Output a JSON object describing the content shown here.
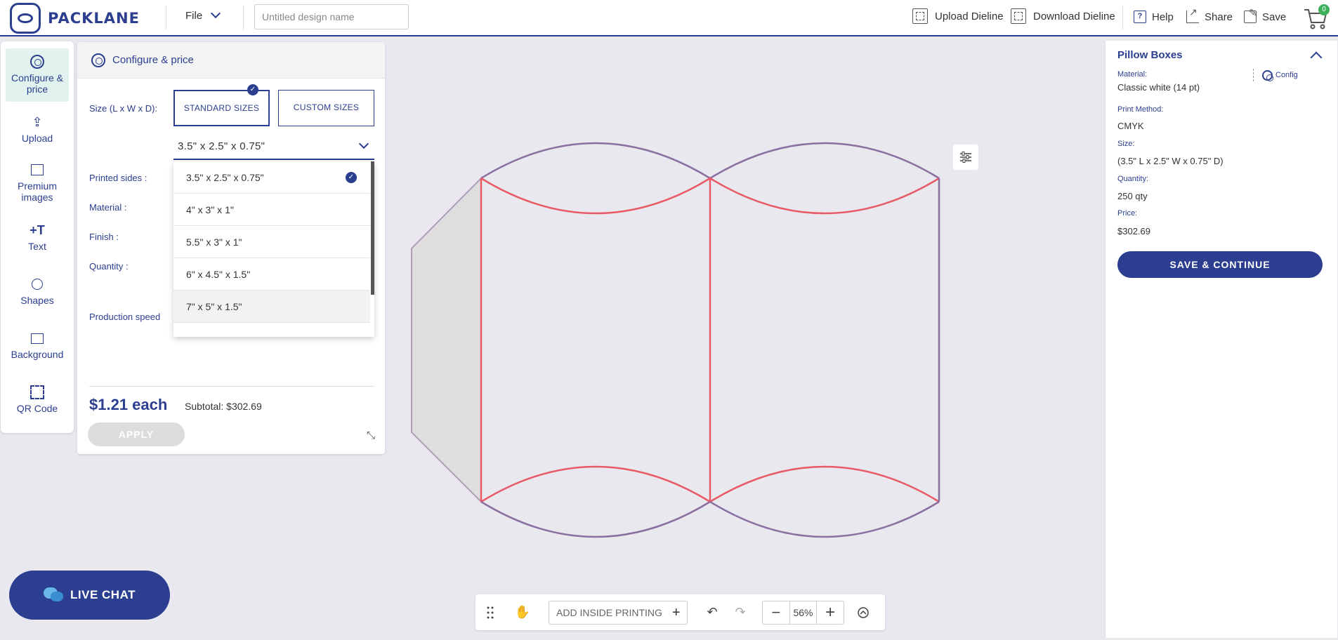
{
  "header": {
    "brand": "PACKLANE",
    "file_menu": "File",
    "design_name_placeholder": "Untitled design name",
    "upload_dieline": "Upload Dieline",
    "download_dieline": "Download Dieline",
    "help": "Help",
    "share": "Share",
    "save": "Save",
    "cart_count": "0"
  },
  "sidebar": {
    "items": [
      {
        "label": "Configure & price",
        "icon": "gear-icon"
      },
      {
        "label": "Upload",
        "icon": "upload-icon"
      },
      {
        "label": "Premium images",
        "icon": "image-icon"
      },
      {
        "label": "Text",
        "icon": "text-icon"
      },
      {
        "label": "Shapes",
        "icon": "shapes-icon"
      },
      {
        "label": "Background",
        "icon": "background-icon"
      },
      {
        "label": "QR Code",
        "icon": "qr-code-icon"
      }
    ]
  },
  "config": {
    "title": "Configure & price",
    "size_label": "Size (L x W x D):",
    "standard_sizes": "STANDARD SIZES",
    "custom_sizes": "CUSTOM SIZES",
    "selected_size": "3.5\" x 2.5\" x 0.75\"",
    "printed_sides_label": "Printed sides :",
    "material_label": "Material :",
    "finish_label": "Finish :",
    "quantity_label": "Quantity :",
    "production_speed_label": "Production speed",
    "size_options": [
      "3.5\" x 2.5\" x 0.75\"",
      "4\" x 3\" x 1\"",
      "5.5\" x 3\" x 1\"",
      "6\" x 4.5\" x 1.5\"",
      "7\" x 5\" x 1.5\""
    ],
    "price_each": "$1.21 each",
    "subtotal": "Subtotal: $302.69",
    "apply": "APPLY"
  },
  "summary": {
    "title": "Pillow Boxes",
    "config_link": "Config",
    "material_label": "Material:",
    "material_value": "Classic white (14 pt)",
    "print_method_label": "Print Method:",
    "print_method_value": "CMYK",
    "size_label": "Size:",
    "size_value": "(3.5\" L x 2.5\" W x 0.75\" D)",
    "quantity_label": "Quantity:",
    "quantity_value": "250 qty",
    "price_label": "Price:",
    "price_value": "$302.69",
    "save_continue": "SAVE & CONTINUE"
  },
  "live_chat": "LIVE CHAT",
  "bottom_toolbar": {
    "add_inside_printing": "ADD INSIDE PRINTING",
    "zoom": "56%"
  },
  "colors": {
    "brand": "#2b3e8f",
    "cut_line": "#e85a66",
    "fold_line": "#8a6fa0",
    "active_bg": "#e2f3ef"
  }
}
